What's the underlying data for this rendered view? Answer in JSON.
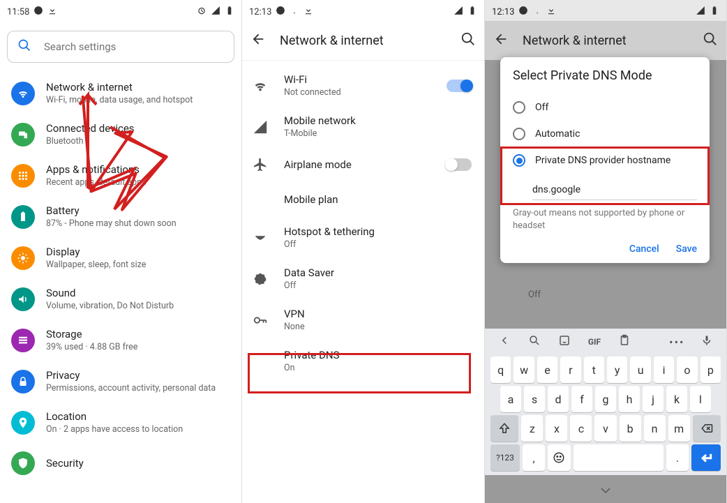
{
  "panel1": {
    "time": "11:58",
    "search_placeholder": "Search settings",
    "items": [
      {
        "title": "Network & internet",
        "sub": "Wi-Fi, mobile, data usage, and hotspot"
      },
      {
        "title": "Connected devices",
        "sub": "Bluetooth"
      },
      {
        "title": "Apps & notifications",
        "sub": "Recent apps, default apps"
      },
      {
        "title": "Battery",
        "sub": "87% - Phone may shut down soon"
      },
      {
        "title": "Display",
        "sub": "Wallpaper, sleep, font size"
      },
      {
        "title": "Sound",
        "sub": "Volume, vibration, Do Not Disturb"
      },
      {
        "title": "Storage",
        "sub": "39% used · 4.88 GB free"
      },
      {
        "title": "Privacy",
        "sub": "Permissions, account activity, personal data"
      },
      {
        "title": "Location",
        "sub": "On · 2 apps have access to location"
      },
      {
        "title": "Security",
        "sub": ""
      }
    ]
  },
  "panel2": {
    "time": "12:13",
    "title": "Network & internet",
    "items": [
      {
        "title": "Wi-Fi",
        "sub": "Not connected",
        "toggle": "on"
      },
      {
        "title": "Mobile network",
        "sub": "T-Mobile"
      },
      {
        "title": "Airplane mode",
        "sub": "",
        "toggle": "off"
      },
      {
        "title": "Mobile plan",
        "sub": ""
      },
      {
        "title": "Hotspot & tethering",
        "sub": "Off"
      },
      {
        "title": "Data Saver",
        "sub": "Off"
      },
      {
        "title": "VPN",
        "sub": "None"
      },
      {
        "title": "Private DNS",
        "sub": "On"
      }
    ]
  },
  "panel3": {
    "time": "12:13",
    "title": "Network & internet",
    "behind_sub": "Off",
    "dialog": {
      "title": "Select Private DNS Mode",
      "options": [
        "Off",
        "Automatic",
        "Private DNS provider hostname"
      ],
      "input_value": "dns.google",
      "hint": "Gray-out means not supported by phone or headset",
      "cancel": "Cancel",
      "save": "Save"
    },
    "keyboard": {
      "gif": "GIF",
      "row1": [
        "q",
        "w",
        "e",
        "r",
        "t",
        "y",
        "u",
        "i",
        "o",
        "p"
      ],
      "row2": [
        "a",
        "s",
        "d",
        "f",
        "g",
        "h",
        "j",
        "k",
        "l"
      ],
      "row3": [
        "z",
        "x",
        "c",
        "v",
        "b",
        "n",
        "m"
      ],
      "sym": "?123",
      "comma": ",",
      "period": "."
    }
  }
}
